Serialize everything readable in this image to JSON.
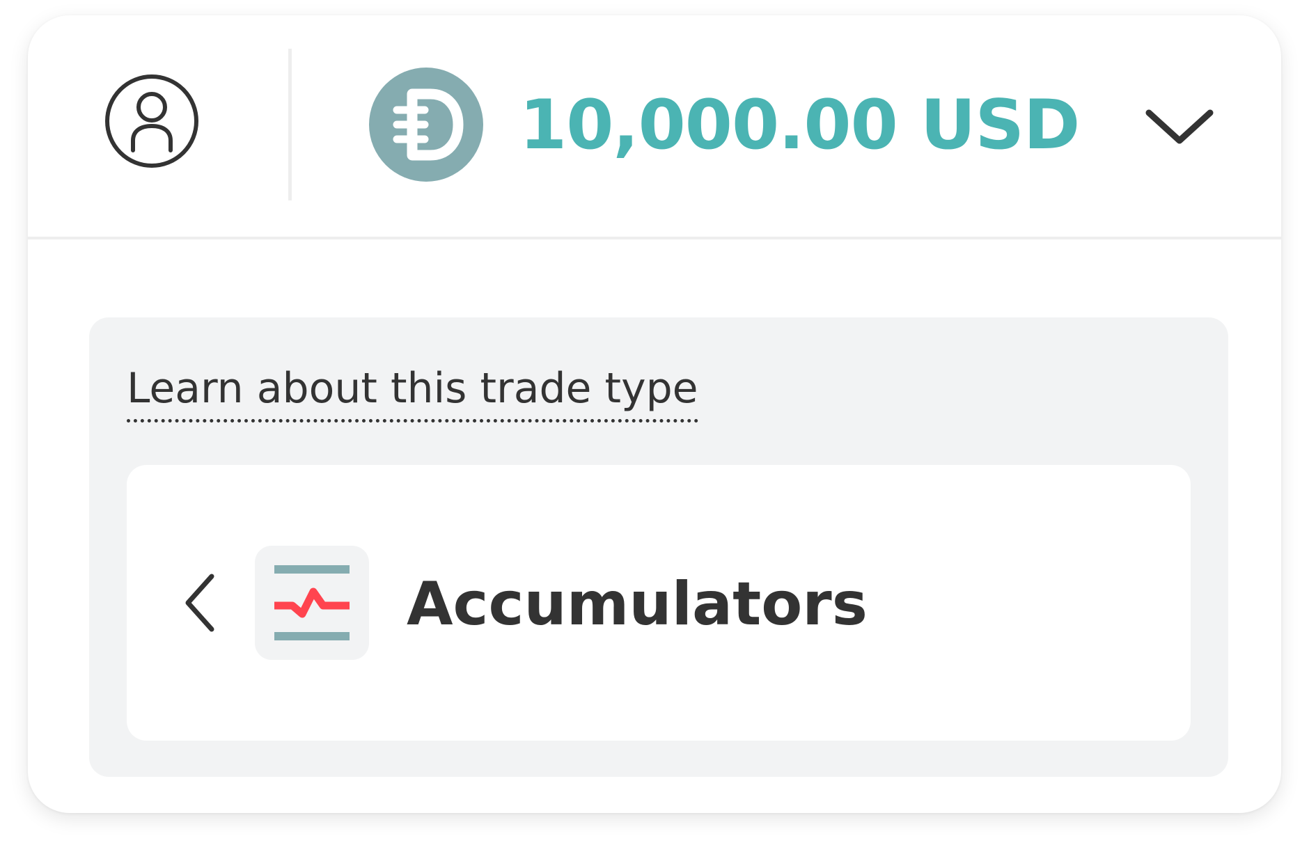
{
  "header": {
    "profile_icon": "user-circle-icon",
    "currency_icon": "deriv-d-coin-icon",
    "balance": "10,000.00 USD",
    "balance_color": "#4bb4b3",
    "dropdown_icon": "chevron-down-icon"
  },
  "trade_panel": {
    "learn_link": "Learn about this trade type",
    "back_icon": "chevron-left-icon",
    "trade_icon": "accumulators-icon",
    "trade_name": "Accumulators"
  },
  "colors": {
    "accent_teal": "#4bb4b3",
    "coin_gray_teal": "#85acb0",
    "loss_red": "#ff444f",
    "text_dark": "#333333",
    "panel_bg": "#f2f3f4"
  }
}
